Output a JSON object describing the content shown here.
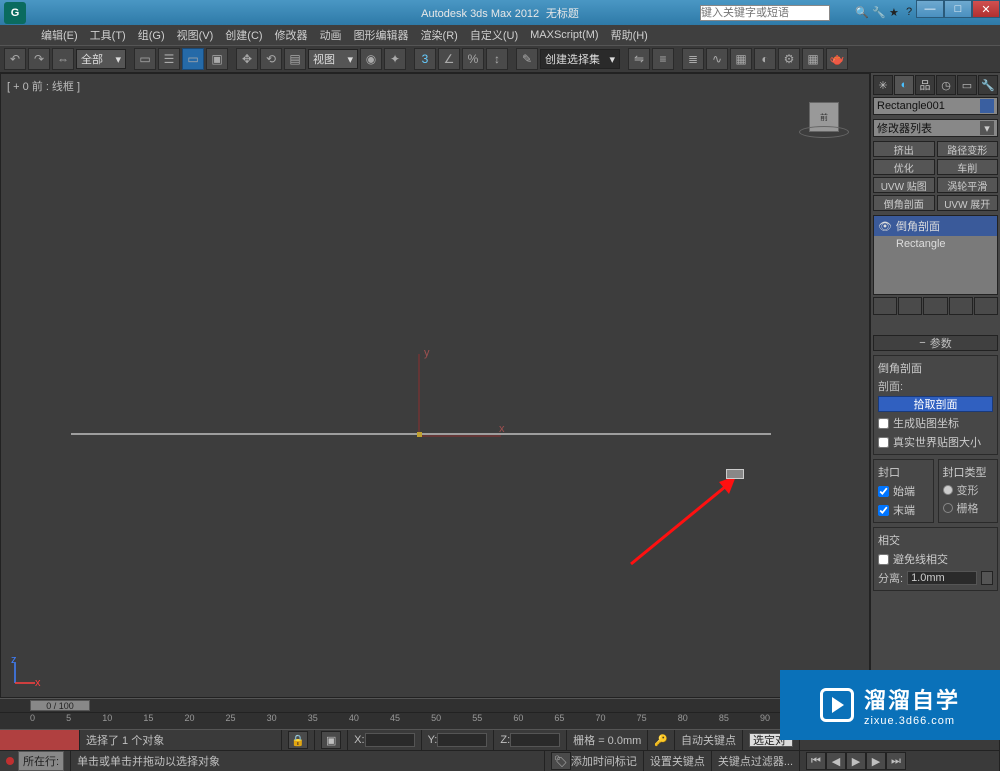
{
  "title": {
    "app": "Autodesk 3ds Max  2012",
    "doc": "无标题"
  },
  "search_placeholder": "键入关键字或短语",
  "menus": [
    "编辑(E)",
    "工具(T)",
    "组(G)",
    "视图(V)",
    "创建(C)",
    "修改器",
    "动画",
    "图形编辑器",
    "渲染(R)",
    "自定义(U)",
    "MAXScript(M)",
    "帮助(H)"
  ],
  "toolbar_combo_all": "全部",
  "toolbar_combo_view": "视图",
  "toolbar_combo_selset": "创建选择集",
  "viewport_label": "[ + 0 前 : 线框 ]",
  "viewcube_face": "前",
  "cmdpanel": {
    "object_name": "Rectangle001",
    "modifier_list_label": "修改器列表",
    "buttons": [
      "挤出",
      "路径变形",
      "优化",
      "车削",
      "UVW 贴图",
      "涡轮平滑",
      "倒角剖面",
      "UVW 展开"
    ],
    "stack": {
      "mod": "倒角剖面",
      "base": "Rectangle"
    },
    "rollout_title": "参数",
    "bevel_group": {
      "title": "倒角剖面",
      "label_profile": "剖面:",
      "pick_btn": "拾取剖面",
      "chk_genmap": "生成贴图坐标",
      "chk_realworld": "真实世界贴图大小"
    },
    "cap_group": {
      "title": "封口",
      "chk_start": "始端",
      "chk_end": "末端",
      "type_title": "封口类型",
      "radio_morph": "变形",
      "radio_grid": "栅格"
    },
    "intersect_group": {
      "title": "相交",
      "chk_avoid": "避免线相交",
      "label_sep": "分离:",
      "spinner_val": "1.0mm"
    }
  },
  "timeslider_label": "0 / 100",
  "timeline_ticks": [
    "0",
    "5",
    "10",
    "15",
    "20",
    "25",
    "30",
    "35",
    "40",
    "45",
    "50",
    "55",
    "60",
    "65",
    "70",
    "75",
    "80",
    "85",
    "90"
  ],
  "status": {
    "now_label": "所在行:",
    "sel_count": "选择了 1 个对象",
    "hint": "单击或单击并拖动以选择对象",
    "add_time_tag": "添加时间标记",
    "grid_label": "栅格 = 0.0mm",
    "autokey": "自动关键点",
    "selected_filter": "选定对",
    "setkey": "设置关键点",
    "keyfilter": "关键点过滤器..."
  },
  "coords": {
    "x": "X:",
    "y": "Y:",
    "z": "Z:"
  },
  "logo": {
    "big": "溜溜自学",
    "small": "zixue.3d66.com"
  }
}
